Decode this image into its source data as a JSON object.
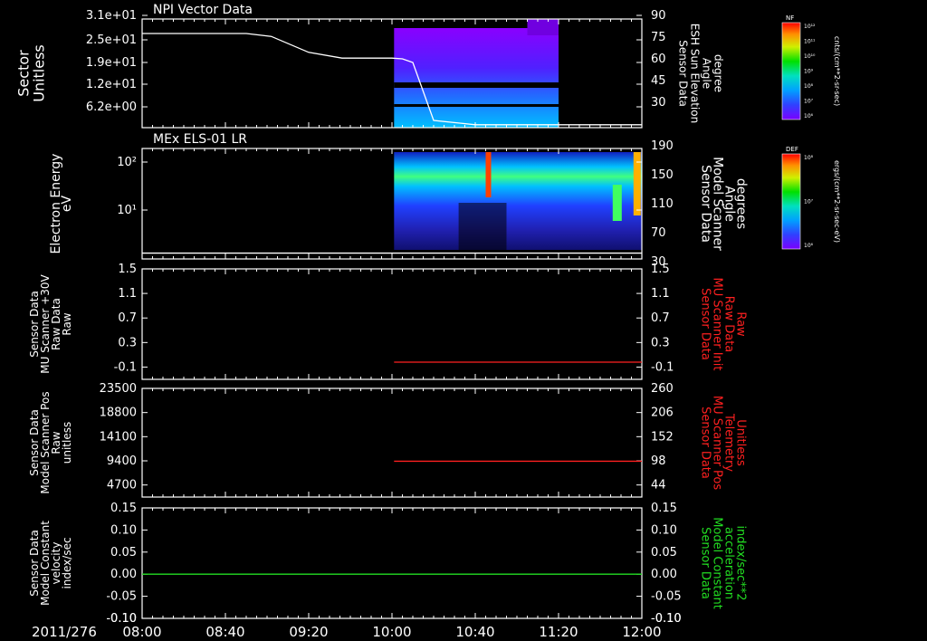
{
  "date_label": "2011/276",
  "x_ticks": [
    "08:00",
    "08:40",
    "09:20",
    "10:00",
    "10:40",
    "11:20",
    "12:00"
  ],
  "colors": {
    "white": "#ffffff",
    "red": "#ff2020",
    "green": "#22dd22",
    "bg": "#000000"
  },
  "chart_data": [
    {
      "type": "heatmap",
      "title": "NPI Vector Data",
      "ylabel": [
        "Sector",
        "Unitless"
      ],
      "y_ticks": [
        "3.1e+01",
        "2.5e+01",
        "1.9e+01",
        "1.2e+01",
        "6.2e+00"
      ],
      "y2label": [
        "Sensor Data",
        "ESH Sun Elevation",
        "Angle",
        "degree"
      ],
      "y2_ticks": [
        "90",
        "75",
        "60",
        "45",
        "30"
      ],
      "y2lim": [
        15,
        90
      ],
      "overlay_line": {
        "x_minutes": [
          0,
          30,
          50,
          62,
          80,
          96,
          120,
          125,
          130,
          135,
          140,
          160,
          200,
          240
        ],
        "values": [
          80,
          80,
          80,
          78,
          67,
          63,
          63,
          62.5,
          60,
          40,
          20,
          17,
          17,
          17
        ]
      },
      "colorbar": {
        "label": "NF",
        "ticks": [
          "10¹²",
          "10¹¹",
          "10¹⁰",
          "10⁹",
          "10⁸",
          "10⁷",
          "10⁶"
        ],
        "unit": "cnts/(cm**2-sr-sec)"
      }
    },
    {
      "type": "heatmap",
      "title": "MEx ELS-01 LR",
      "ylabel": [
        "Electron Energy",
        "eV"
      ],
      "y_ticks": [
        "10²",
        "10¹"
      ],
      "y2label": [
        "Sensor Data",
        "Model Scanner",
        "Angle",
        "degrees"
      ],
      "y2_ticks": [
        "190",
        "150",
        "110",
        "70",
        "30"
      ],
      "y2lim": [
        0,
        190
      ],
      "overlay_line": {
        "x_minutes": [
          0,
          240
        ],
        "values": [
          10,
          10
        ]
      },
      "colorbar": {
        "label": "DEF",
        "ticks": [
          "10⁸",
          "10⁷",
          "10⁶"
        ],
        "unit": "ergs/(cm**2-sr-sec-eV)"
      }
    },
    {
      "type": "line",
      "ylabel": [
        "Sensor Data",
        "MU Scanner +30V",
        "Raw Data",
        "Raw"
      ],
      "y_ticks": [
        "1.5",
        "1.1",
        "0.7",
        "0.3",
        "-0.1"
      ],
      "y2label": [
        "Sensor Data",
        "MU Scanner Init",
        "Raw Data",
        "Raw"
      ],
      "y2_ticks": [
        "1.5",
        "1.1",
        "0.7",
        "0.3",
        "-0.1"
      ],
      "ylim": [
        -0.3,
        1.5
      ],
      "series": [
        {
          "x_minutes": [
            121,
            240
          ],
          "values": [
            -0.02,
            -0.02
          ],
          "color": "#ff2020"
        }
      ]
    },
    {
      "type": "line",
      "ylabel": [
        "Sensor Data",
        "Model Scanner Pos",
        "Raw",
        "unitless"
      ],
      "y_ticks": [
        "23500",
        "18800",
        "14100",
        "9400",
        "4700"
      ],
      "y2label": [
        "Sensor Data",
        "MU Scanner Pos",
        "Telemetry",
        "Unitless"
      ],
      "y2_ticks": [
        "260",
        "206",
        "152",
        "98",
        "44"
      ],
      "ylim": [
        0,
        23500
      ],
      "y2lim": [
        0,
        260
      ],
      "series": [
        {
          "x_minutes": [
            121,
            240
          ],
          "values": [
            7750,
            7750
          ],
          "color": "#ff2020"
        }
      ]
    },
    {
      "type": "line",
      "ylabel": [
        "Sensor Data",
        "Model Constant",
        "velocity",
        "index/sec"
      ],
      "y_ticks": [
        "0.15",
        "0.10",
        "0.05",
        "0.00",
        "-0.05",
        "-0.10"
      ],
      "y2label": [
        "Sensor Data",
        "Model Constant",
        "acceleration",
        "index/sec**2"
      ],
      "y2_ticks": [
        "0.15",
        "0.10",
        "0.05",
        "0.00",
        "-0.05",
        "-0.10"
      ],
      "ylim": [
        -0.1,
        0.15
      ],
      "series": [
        {
          "x_minutes": [
            0,
            240
          ],
          "values": [
            0.0,
            0.0
          ],
          "color": "#22dd22"
        }
      ]
    }
  ]
}
